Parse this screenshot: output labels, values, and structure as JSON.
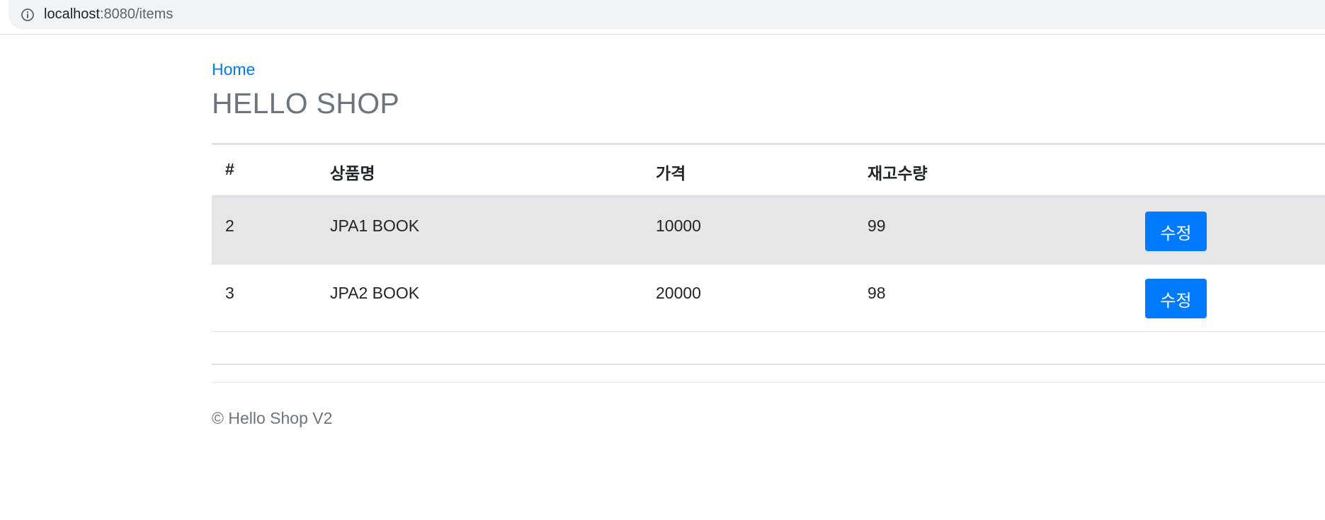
{
  "browser": {
    "url_host": "localhost",
    "url_path": ":8080/items",
    "info_icon": "info-circle-icon"
  },
  "header": {
    "home_link": "Home",
    "title": "HELLO SHOP"
  },
  "table": {
    "columns": [
      "#",
      "상품명",
      "가격",
      "재고수량",
      ""
    ],
    "rows": [
      {
        "id": "2",
        "name": "JPA1 BOOK",
        "price": "10000",
        "stock": "99",
        "action": "수정"
      },
      {
        "id": "3",
        "name": "JPA2 BOOK",
        "price": "20000",
        "stock": "98",
        "action": "수정"
      }
    ]
  },
  "footer": {
    "text": "© Hello Shop V2"
  },
  "colors": {
    "link": "#007bff",
    "button": "#007bff",
    "title": "#6c757d",
    "stripe": "#e6e6e6"
  }
}
